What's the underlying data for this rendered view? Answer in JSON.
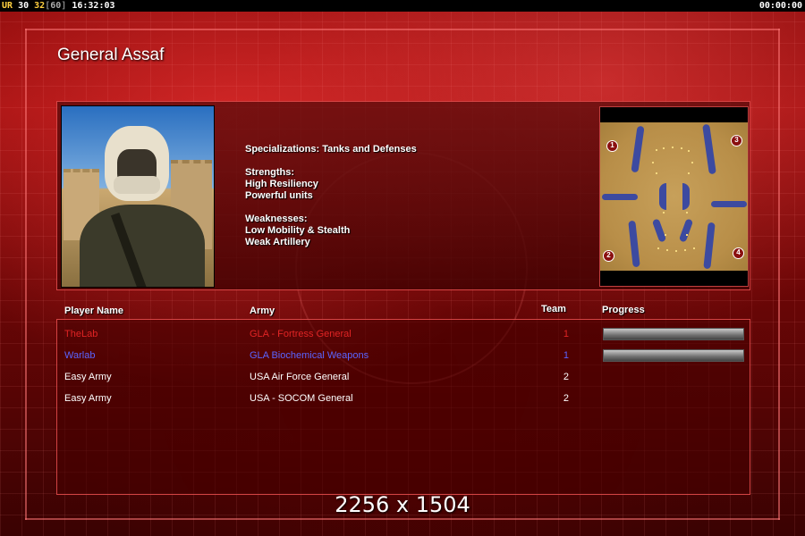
{
  "status_bar": {
    "ur_label": "UR",
    "current": "30",
    "fps": "32",
    "bracket_open": "[",
    "cap": "60",
    "bracket_close": "]",
    "clock": "16:32:03",
    "game_time": "00:00:00"
  },
  "general": {
    "title": "General Assaf",
    "specializations": "Specializations: Tanks and Defenses",
    "strengths_label": "Strengths:",
    "strengths": [
      "High Resiliency",
      "Powerful units"
    ],
    "weaknesses_label": "Weaknesses:",
    "weaknesses": [
      "Low Mobility & Stealth",
      "Weak Artillery"
    ]
  },
  "minimap": {
    "start_positions": [
      "1",
      "2",
      "3",
      "4"
    ]
  },
  "table": {
    "headers": {
      "player_name": "Player Name",
      "army": "Army",
      "team": "Team",
      "progress": "Progress"
    },
    "rows": [
      {
        "name": "TheLab",
        "army": "GLA - Fortress General",
        "team": "1",
        "color": "#e02424",
        "progress": 1.0
      },
      {
        "name": "Warlab",
        "army": "GLA Biochemical Weapons",
        "team": "1",
        "color": "#5a64ff",
        "progress": 1.0
      },
      {
        "name": "Easy Army",
        "army": "USA Air Force General",
        "team": "2",
        "color": "#ffffff",
        "progress": null
      },
      {
        "name": "Easy Army",
        "army": "USA - SOCOM General",
        "team": "2",
        "color": "#ffffff",
        "progress": null
      }
    ]
  },
  "overlay": {
    "resolution": "2256 x 1504"
  },
  "colors": {
    "frame": "#ff5a5a",
    "background": "#8a0a0a"
  }
}
